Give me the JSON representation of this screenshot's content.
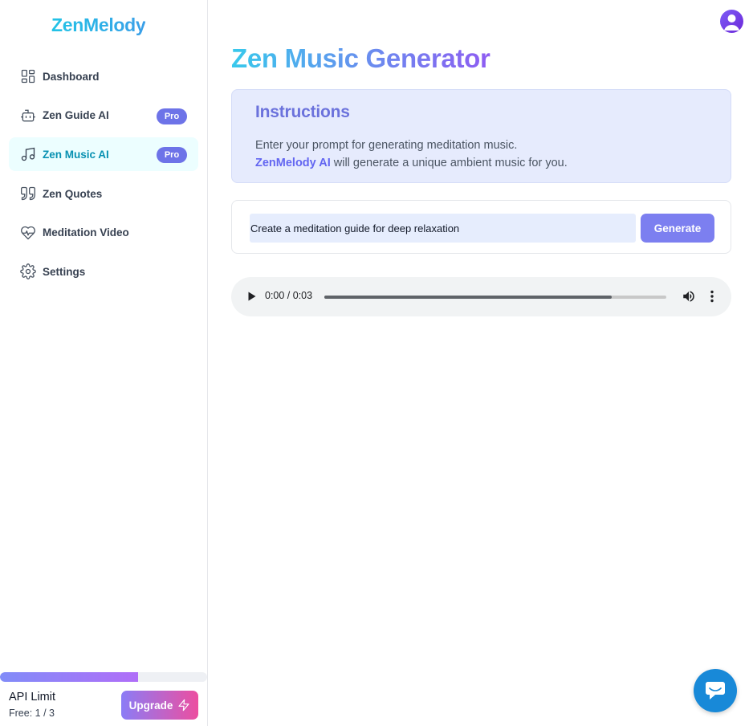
{
  "app": {
    "name": "ZenMelody"
  },
  "sidebar": {
    "items": [
      {
        "label": "Dashboard",
        "icon": "dashboard-icon",
        "pro": ""
      },
      {
        "label": "Zen Guide AI",
        "icon": "bot-icon",
        "pro": "Pro"
      },
      {
        "label": "Zen Music AI",
        "icon": "music-note-icon",
        "pro": "Pro",
        "active": true
      },
      {
        "label": "Zen Quotes",
        "icon": "quote-icon",
        "pro": ""
      },
      {
        "label": "Meditation Video",
        "icon": "heart-pulse-icon",
        "pro": ""
      },
      {
        "label": "Settings",
        "icon": "gear-icon",
        "pro": ""
      }
    ],
    "api_limit": {
      "title": "API Limit",
      "count_text": "Free: 1 / 3",
      "used": 1,
      "total": 3
    },
    "upgrade_label": "Upgrade"
  },
  "main": {
    "title": "Zen Music Generator",
    "instructions": {
      "heading": "Instructions",
      "line1": "Enter your prompt for generating meditation music.",
      "brand": "ZenMelody AI",
      "line2_rest": " will generate a unique ambient music for you."
    },
    "prompt": {
      "value": "Create a meditation guide for deep relaxation",
      "button": "Generate"
    },
    "player": {
      "time": "0:00 / 0:03",
      "progress": 0.84
    }
  },
  "colors": {
    "accent": "#0891b2",
    "pro_badge": "#6d73e8",
    "generate_button": "#7c7ff0",
    "chat_button": "#1889d8"
  }
}
